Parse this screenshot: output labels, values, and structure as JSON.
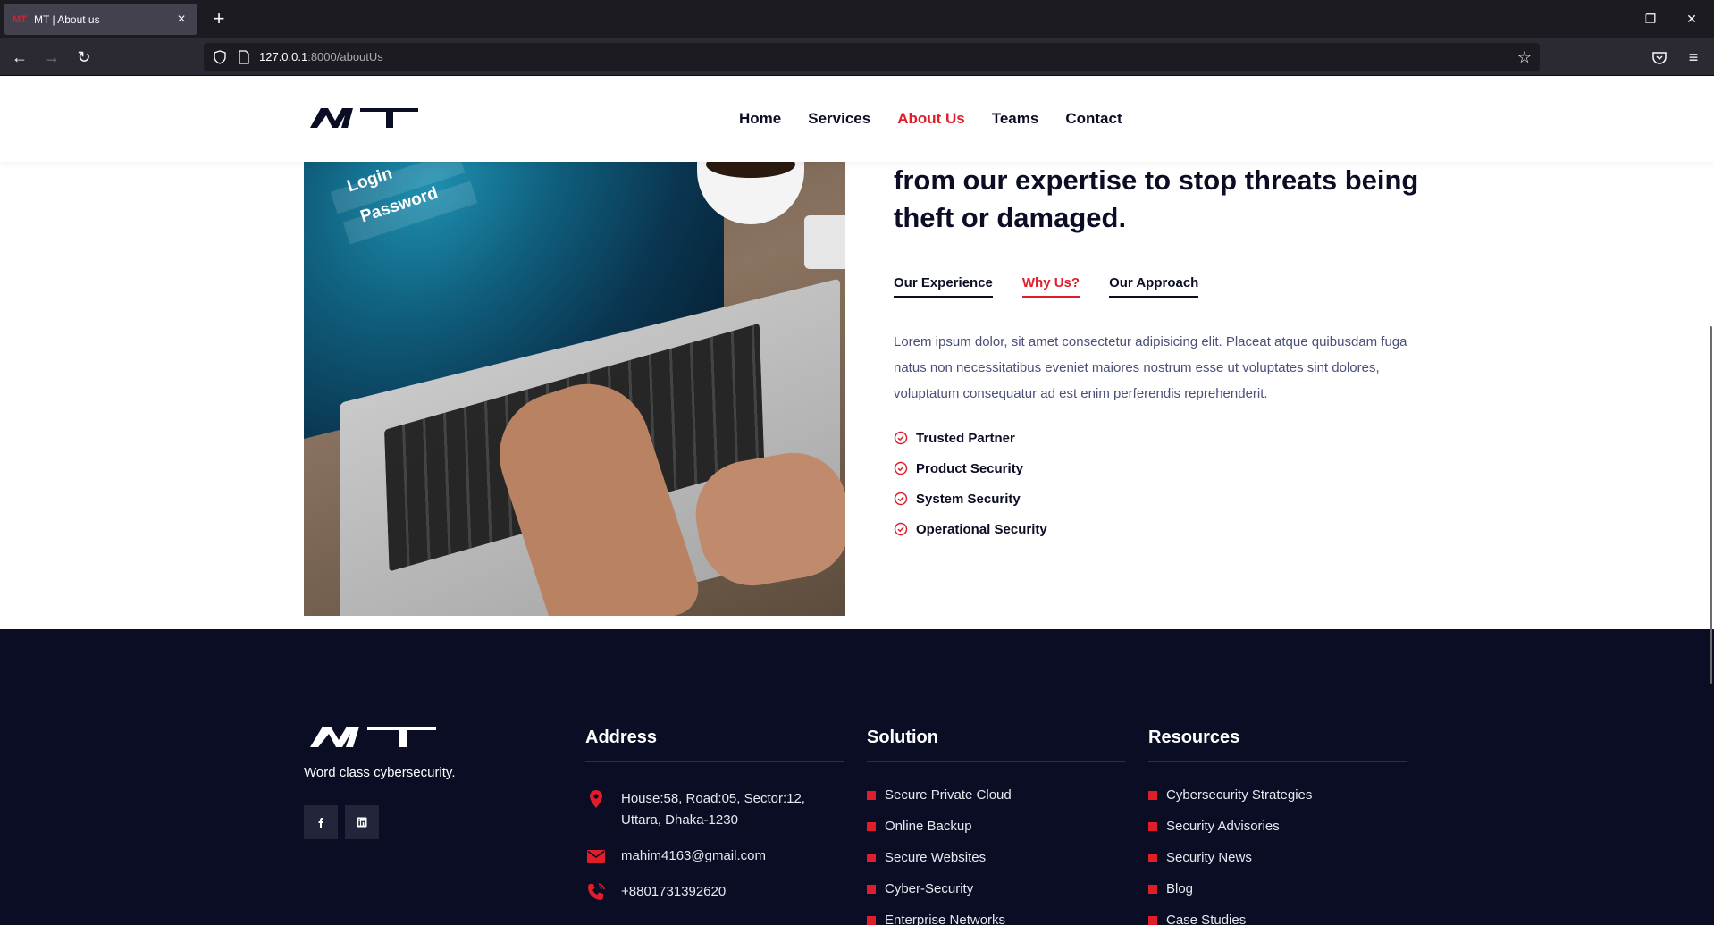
{
  "browser": {
    "tab_title": "MT | About us",
    "tab_favicon": "MT",
    "url_host": "127.0.0.1",
    "url_rest": ":8000/aboutUs"
  },
  "header": {
    "logo_text": "MT",
    "nav": [
      {
        "label": "Home",
        "active": false
      },
      {
        "label": "Services",
        "active": false
      },
      {
        "label": "About Us",
        "active": true
      },
      {
        "label": "Teams",
        "active": false
      },
      {
        "label": "Contact",
        "active": false
      }
    ]
  },
  "about": {
    "image_text_login": "Login",
    "image_text_password": "Password",
    "headline": "from our expertise to stop threats being theft or damaged.",
    "tabs": [
      {
        "label": "Our Experience",
        "active": false
      },
      {
        "label": "Why Us?",
        "active": true
      },
      {
        "label": "Our Approach",
        "active": false
      }
    ],
    "description": "Lorem ipsum dolor, sit amet consectetur adipisicing elit. Placeat atque quibusdam fuga natus non necessitatibus eveniet maiores nostrum esse ut voluptates sint dolores, voluptatum consequatur ad est enim perferendis reprehenderit.",
    "checklist": [
      "Trusted Partner",
      "Product Security",
      "System Security",
      "Operational Security"
    ]
  },
  "footer": {
    "logo_text": "MT",
    "tagline": "Word class cybersecurity.",
    "social": [
      "facebook-icon",
      "linkedin-icon"
    ],
    "address": {
      "title": "Address",
      "location": "House:58, Road:05, Sector:12, Uttara, Dhaka-1230",
      "email": "mahim4163@gmail.com",
      "phone": "+8801731392620"
    },
    "solution": {
      "title": "Solution",
      "items": [
        "Secure Private Cloud",
        "Online Backup",
        "Secure Websites",
        "Cyber-Security",
        "Enterprise Networks"
      ]
    },
    "resources": {
      "title": "Resources",
      "items": [
        "Cybersecurity Strategies",
        "Security Advisories",
        "Security News",
        "Blog",
        "Case Studies"
      ]
    }
  },
  "colors": {
    "accent": "#e11d2a",
    "dark_navy": "#0b0d24",
    "text_muted": "#4a4f78"
  }
}
